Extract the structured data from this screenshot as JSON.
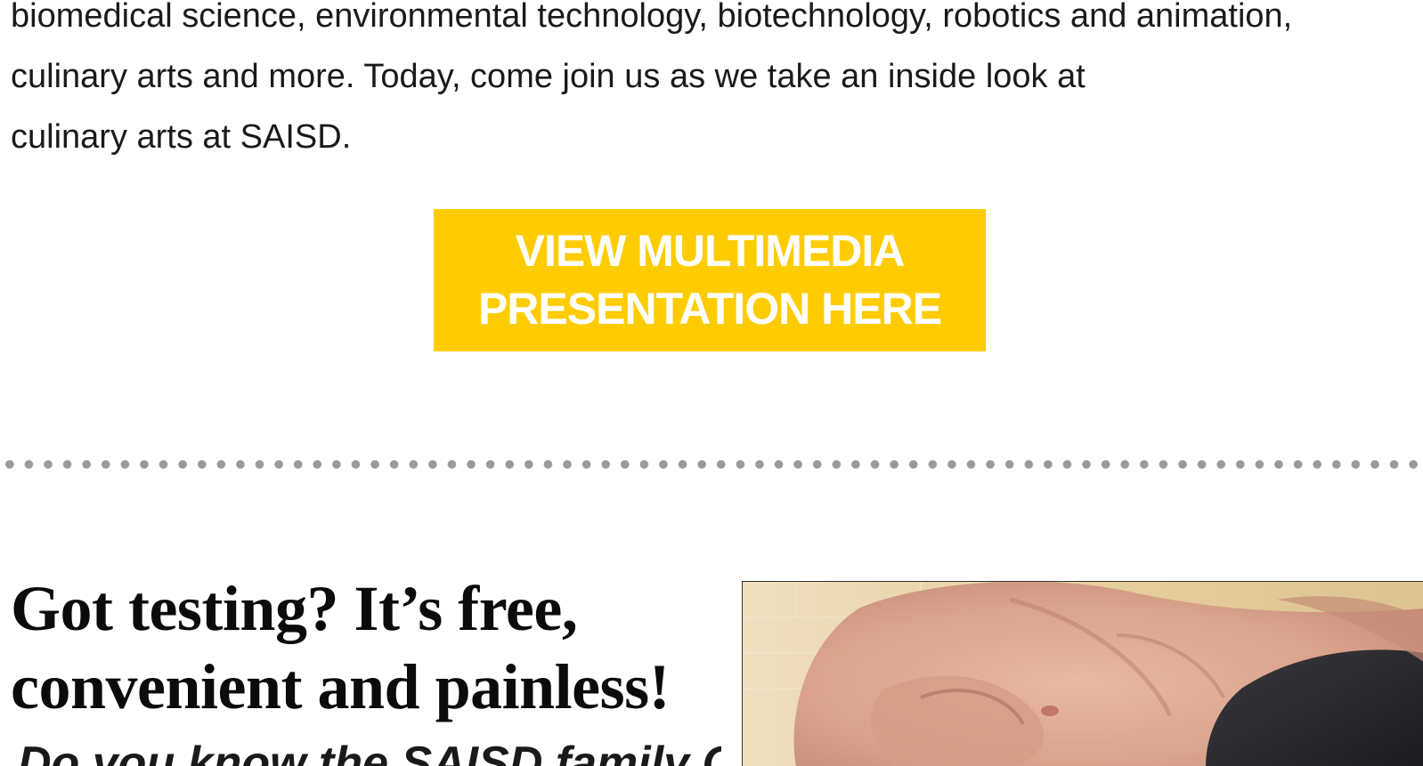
{
  "intro": {
    "lines": [
      "biomedical science, environmental technology, biotechnology, robotics and animation,",
      "culinary arts and more. Today, come join us as we take an inside look at",
      "culinary arts at SAISD."
    ]
  },
  "cta": {
    "lines": [
      "VIEW MULTIMEDIA",
      "PRESENTATION HERE"
    ],
    "background_color": "#fecc00",
    "text_color": "#ffffff"
  },
  "divider": {
    "style": "dotted",
    "color": "#9a9a9a"
  },
  "article": {
    "headline_lines": [
      "Got testing? It’s free,",
      "convenient and painless!"
    ],
    "subhead_partial": "Do you know the SAISD family Covid",
    "photo": {
      "description_icon": "hand-finger-prick-photo"
    }
  }
}
